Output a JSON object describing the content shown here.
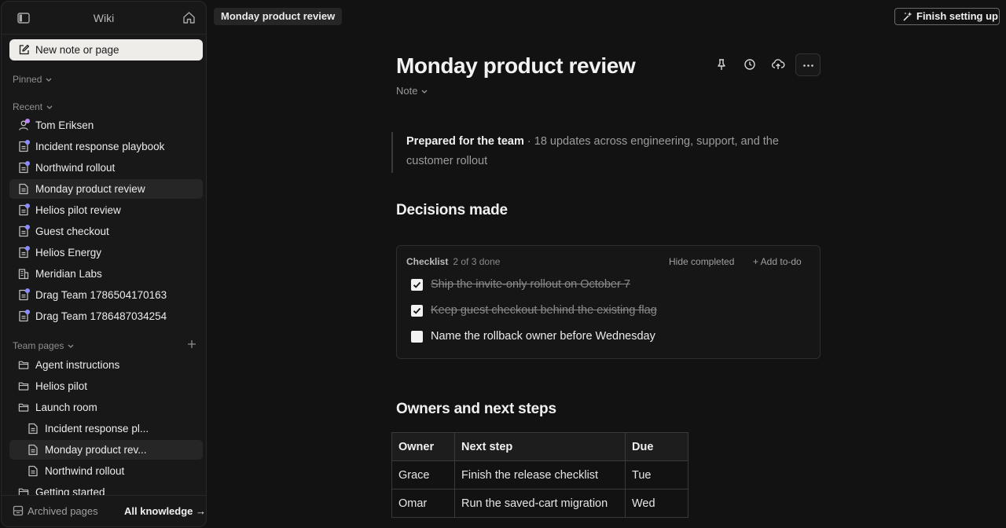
{
  "sidebar": {
    "title": "Wiki",
    "new_note_label": "New note or page",
    "pinned_label": "Pinned",
    "recent_label": "Recent",
    "recent_items": [
      {
        "label": "Tom Eriksen",
        "icon": "person-icon",
        "dot_color": "#c084fc"
      },
      {
        "label": "Incident response playbook",
        "icon": "document-icon",
        "dot_color": "#8b8cff"
      },
      {
        "label": "Northwind rollout",
        "icon": "document-icon",
        "dot_color": "#8b8cff"
      },
      {
        "label": "Monday product review",
        "icon": "document-icon",
        "active": true
      },
      {
        "label": "Helios pilot review",
        "icon": "document-icon",
        "dot_color": "#8b8cff"
      },
      {
        "label": "Guest checkout",
        "icon": "document-icon",
        "dot_color": "#8b8cff"
      },
      {
        "label": "Helios Energy",
        "icon": "document-icon",
        "dot_color": "#8b8cff"
      },
      {
        "label": "Meridian Labs",
        "icon": "building-icon"
      },
      {
        "label": "Drag Team 1786504170163",
        "icon": "document-icon",
        "dot_color": "#8b8cff"
      },
      {
        "label": "Drag Team 1786487034254",
        "icon": "document-icon",
        "dot_color": "#8b8cff"
      }
    ],
    "team_pages_label": "Team pages",
    "team_items": [
      {
        "label": "Agent instructions",
        "icon": "folder-icon"
      },
      {
        "label": "Helios pilot",
        "icon": "folder-icon"
      },
      {
        "label": "Launch room",
        "icon": "folder-icon"
      },
      {
        "label": "Incident response pl...",
        "icon": "document-icon",
        "child": true
      },
      {
        "label": "Monday product rev...",
        "icon": "document-icon",
        "child": true,
        "active": true
      },
      {
        "label": "Northwind rollout",
        "icon": "document-icon",
        "child": true
      },
      {
        "label": "Getting started",
        "icon": "folder-icon"
      }
    ],
    "archived_label": "Archived pages",
    "all_knowledge_label": "All knowledge →"
  },
  "topbar": {
    "breadcrumb": "Monday product review",
    "finish_setup_label": "Finish setting up"
  },
  "doc": {
    "title": "Monday product review",
    "type_label": "Note",
    "callout_strong": "Prepared for the team",
    "callout_text": " · 18 updates across engineering, support, and the customer rollout",
    "decisions_heading": "Decisions made",
    "checklist": {
      "title": "Checklist",
      "count": "2 of 3 done",
      "hide_label": "Hide completed",
      "add_label": "+ Add to-do",
      "items": [
        {
          "text": "Ship the invite-only rollout on October 7",
          "done": true
        },
        {
          "text": "Keep guest checkout behind the existing flag",
          "done": true
        },
        {
          "text": "Name the rollback owner before Wednesday",
          "done": false
        }
      ]
    },
    "owners_heading": "Owners and next steps",
    "table": {
      "headers": [
        "Owner",
        "Next step",
        "Due"
      ],
      "rows": [
        [
          "Grace",
          "Finish the release checklist",
          "Tue"
        ],
        [
          "Omar",
          "Run the saved-cart migration",
          "Wed"
        ]
      ]
    }
  },
  "colors": {
    "background": "#121212",
    "sidebar": "#181818",
    "accent_dot": "#8b8cff",
    "person_dot": "#c084fc"
  }
}
